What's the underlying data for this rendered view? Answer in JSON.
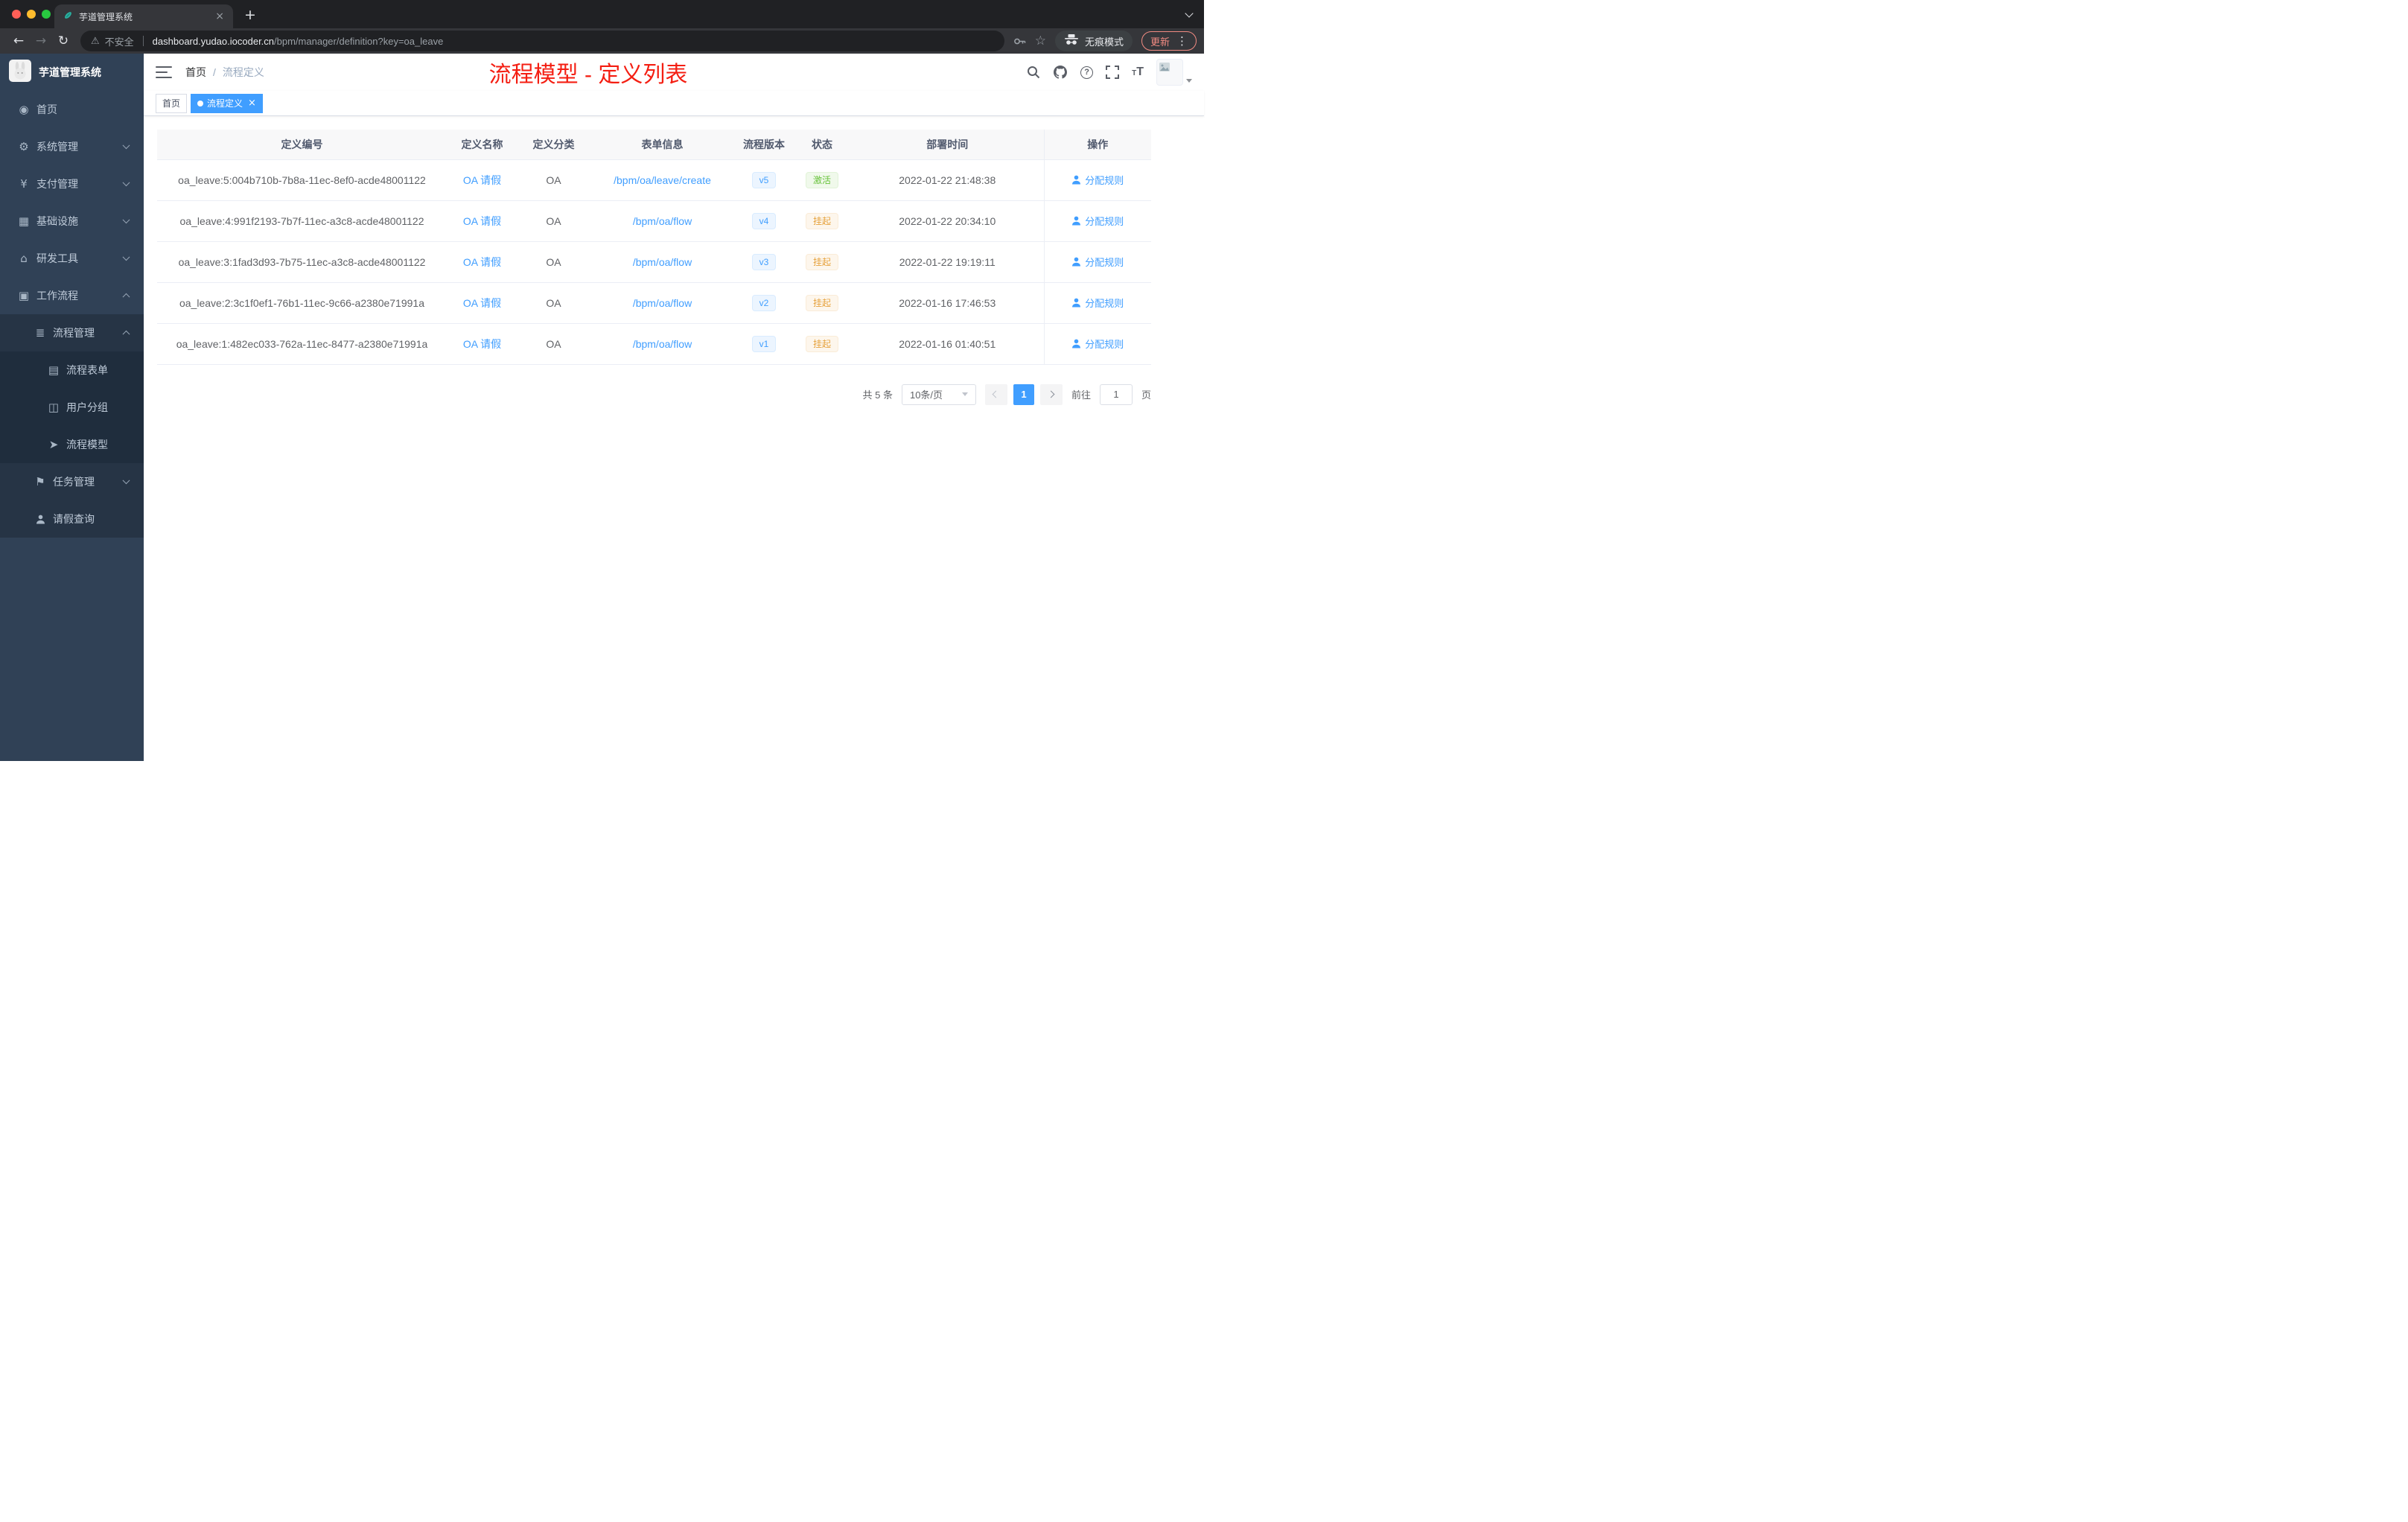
{
  "browser": {
    "tab_title": "芋道管理系统",
    "security_label": "不安全",
    "url_host": "dashboard.yudao.iocoder.cn",
    "url_path": "/bpm/manager/definition?key=oa_leave",
    "incognito_label": "无痕模式",
    "update_label": "更新"
  },
  "sidebar": {
    "logo_title": "芋道管理系统",
    "items": [
      {
        "label": "首页",
        "icon": "dashboard-icon",
        "level": 1
      },
      {
        "label": "系统管理",
        "icon": "gear-icon",
        "level": 1,
        "chevron": "down"
      },
      {
        "label": "支付管理",
        "icon": "yen-icon",
        "level": 1,
        "chevron": "down"
      },
      {
        "label": "基础设施",
        "icon": "infrastructure-icon",
        "level": 1,
        "chevron": "down"
      },
      {
        "label": "研发工具",
        "icon": "tools-icon",
        "level": 1,
        "chevron": "down"
      },
      {
        "label": "工作流程",
        "icon": "workflow-icon",
        "level": 1,
        "chevron": "up"
      },
      {
        "label": "流程管理",
        "icon": "process-management-icon",
        "level": 2,
        "chevron": "up"
      },
      {
        "label": "流程表单",
        "icon": "form-icon",
        "level": 3
      },
      {
        "label": "用户分组",
        "icon": "user-group-icon",
        "level": 3
      },
      {
        "label": "流程模型",
        "icon": "process-model-icon",
        "level": 3
      },
      {
        "label": "任务管理",
        "icon": "task-icon",
        "level": 2,
        "chevron": "down"
      },
      {
        "label": "请假查询",
        "icon": "person-icon",
        "level": 2
      }
    ]
  },
  "header": {
    "breadcrumb": [
      "首页",
      "流程定义"
    ],
    "annotation": "流程模型 - 定义列表"
  },
  "tags": [
    {
      "label": "首页",
      "active": false
    },
    {
      "label": "流程定义",
      "active": true
    }
  ],
  "table": {
    "columns": [
      "定义编号",
      "定义名称",
      "定义分类",
      "表单信息",
      "流程版本",
      "状态",
      "部署时间",
      "操作"
    ],
    "rows": [
      {
        "id": "oa_leave:5:004b710b-7b8a-11ec-8ef0-acde48001122",
        "name": "OA 请假",
        "category": "OA",
        "form": "/bpm/oa/leave/create",
        "version": "v5",
        "status": "激活",
        "status_type": "success",
        "deployed_at": "2022-01-22 21:48:38",
        "action": "分配规则"
      },
      {
        "id": "oa_leave:4:991f2193-7b7f-11ec-a3c8-acde48001122",
        "name": "OA 请假",
        "category": "OA",
        "form": "/bpm/oa/flow",
        "version": "v4",
        "status": "挂起",
        "status_type": "warning",
        "deployed_at": "2022-01-22 20:34:10",
        "action": "分配规则"
      },
      {
        "id": "oa_leave:3:1fad3d93-7b75-11ec-a3c8-acde48001122",
        "name": "OA 请假",
        "category": "OA",
        "form": "/bpm/oa/flow",
        "version": "v3",
        "status": "挂起",
        "status_type": "warning",
        "deployed_at": "2022-01-22 19:19:11",
        "action": "分配规则"
      },
      {
        "id": "oa_leave:2:3c1f0ef1-76b1-11ec-9c66-a2380e71991a",
        "name": "OA 请假",
        "category": "OA",
        "form": "/bpm/oa/flow",
        "version": "v2",
        "status": "挂起",
        "status_type": "warning",
        "deployed_at": "2022-01-16 17:46:53",
        "action": "分配规则"
      },
      {
        "id": "oa_leave:1:482ec033-762a-11ec-8477-a2380e71991a",
        "name": "OA 请假",
        "category": "OA",
        "form": "/bpm/oa/flow",
        "version": "v1",
        "status": "挂起",
        "status_type": "warning",
        "deployed_at": "2022-01-16 01:40:51",
        "action": "分配规则"
      }
    ]
  },
  "pagination": {
    "total_label": "共 5 条",
    "page_size_label": "10条/页",
    "current_page": "1",
    "goto_label": "前往",
    "goto_value": "1",
    "page_unit_label": "页"
  },
  "colors": {
    "accent": "#409eff",
    "success": "#67c23a",
    "warning": "#e6a23c",
    "annotation": "#f41e12",
    "sidebar_bg": "#304156"
  }
}
